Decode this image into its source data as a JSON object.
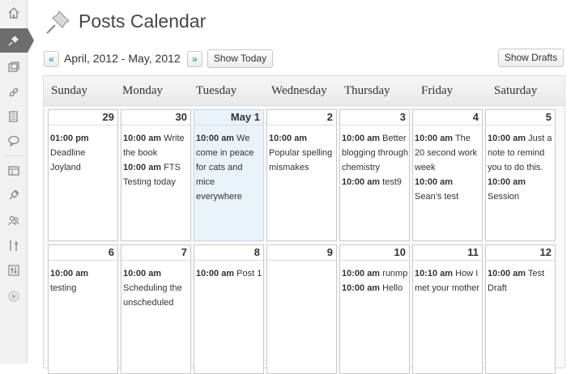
{
  "page": {
    "title": "Posts Calendar"
  },
  "nav": {
    "prev_label": "«",
    "next_label": "»",
    "date_range": "April, 2012 - May, 2012",
    "show_today_label": "Show Today",
    "show_drafts_label": "Show Drafts"
  },
  "sidebar": {
    "items": [
      {
        "icon": "dashboard-icon"
      },
      {
        "icon": "pushpin-icon",
        "active": true
      },
      {
        "icon": "media-icon"
      },
      {
        "icon": "links-icon"
      },
      {
        "icon": "pages-icon"
      },
      {
        "icon": "comments-icon"
      },
      {
        "icon": "appearance-icon"
      },
      {
        "icon": "plugins-icon"
      },
      {
        "icon": "users-icon"
      },
      {
        "icon": "tools-icon"
      },
      {
        "icon": "settings-icon"
      },
      {
        "icon": "collapse-icon"
      }
    ]
  },
  "calendar": {
    "weekdays": [
      "Sunday",
      "Monday",
      "Tuesday",
      "Wednesday",
      "Thursday",
      "Friday",
      "Saturday"
    ],
    "weeks": [
      [
        {
          "num": "29",
          "events": [
            {
              "time": "01:00 pm",
              "title": "Deadline Joyland"
            }
          ]
        },
        {
          "num": "30",
          "events": [
            {
              "time": "10:00 am",
              "title": "Write the book"
            },
            {
              "time": "10:00 am",
              "title": "FTS Testing today"
            }
          ]
        },
        {
          "num": "May 1",
          "today": true,
          "events": [
            {
              "time": "10:00 am",
              "title": "We come in peace for cats and mice everywhere"
            }
          ]
        },
        {
          "num": "2",
          "events": [
            {
              "time": "10:00 am",
              "title": "Popular spelling mismakes"
            }
          ]
        },
        {
          "num": "3",
          "events": [
            {
              "time": "10:00 am",
              "title": "Better blogging through chemistry"
            },
            {
              "time": "10:00 am",
              "title": "test9"
            }
          ]
        },
        {
          "num": "4",
          "events": [
            {
              "time": "10:00 am",
              "title": "The 20 second work week"
            },
            {
              "time": "10:00 am",
              "title": "Sean’s test"
            }
          ]
        },
        {
          "num": "5",
          "events": [
            {
              "time": "10:00 am",
              "title": "Just a note to remind you to do this."
            },
            {
              "time": "10:00 am",
              "title": "Session"
            }
          ]
        }
      ],
      [
        {
          "num": "6",
          "events": [
            {
              "time": "10:00 am",
              "title": "testing"
            }
          ]
        },
        {
          "num": "7",
          "events": [
            {
              "time": "10:00 am",
              "title": "Scheduling the unscheduled"
            }
          ]
        },
        {
          "num": "8",
          "events": [
            {
              "time": "10:00 am",
              "title": "Post 1"
            }
          ]
        },
        {
          "num": "9",
          "events": []
        },
        {
          "num": "10",
          "events": [
            {
              "time": "10:00 am",
              "title": "runmp"
            },
            {
              "time": "10:00 am",
              "title": "Hello"
            }
          ]
        },
        {
          "num": "11",
          "events": [
            {
              "time": "10:10 am",
              "title": "How I met your mother"
            }
          ]
        },
        {
          "num": "12",
          "events": [
            {
              "time": "10:00 am",
              "title": "Test Draft"
            }
          ]
        }
      ]
    ]
  }
}
